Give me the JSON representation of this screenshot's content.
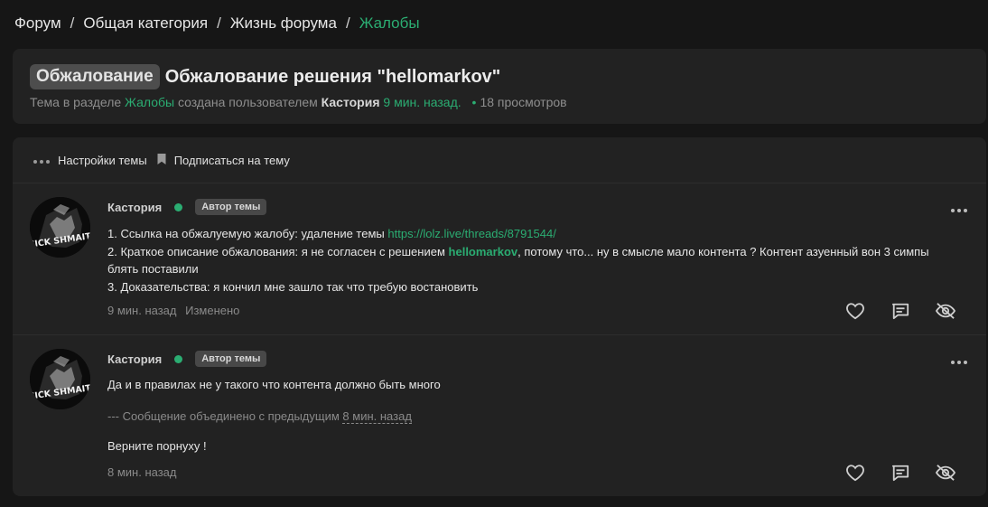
{
  "breadcrumb": {
    "items": [
      "Форум",
      "Общая категория",
      "Жизнь форума",
      "Жалобы"
    ],
    "separator": "/"
  },
  "thread": {
    "prefix": "Обжалование",
    "title": "Обжалование решения \"hellomarkov\"",
    "meta": {
      "text1": "Тема в разделе",
      "section": "Жалобы",
      "text2": "создана пользователем",
      "author": "Кастория",
      "time": "9 мин. назад.",
      "dot": "•",
      "views": "18 просмотров"
    }
  },
  "tools": {
    "settings": "Настройки темы",
    "subscribe": "Подписаться на тему"
  },
  "posts": [
    {
      "author": "Кастория",
      "badge": "Автор темы",
      "line1_text": "1. Ссылка на обжалуемую жалобу: удаление темы",
      "line1_link": "https://lolz.live/threads/8791544/",
      "line2_pre": "2. Краткое описание обжалования: я не согласен с решением",
      "line2_user": "hellomarkov",
      "line2_post": ", потому что... ну в смысле мало контента ? Контент азуенный вон 3 симпы",
      "line3": "блять поставили",
      "line4": "3. Доказательства: я кончил мне зашло так что требую востановить",
      "time": "9 мин. назад",
      "edited": "Изменено"
    },
    {
      "author": "Кастория",
      "badge": "Автор темы",
      "line1": "Да и в правилах не у такого что контента должно быть много",
      "merged_pre": "--- Сообщение объединено с предыдущим",
      "merged_time": "8 мин. назад",
      "line2": "Верните порнуху !",
      "time": "8 мин. назад"
    }
  ],
  "avatar_text": "NICK SHMAIT",
  "colors": {
    "accent": "#2bad72",
    "background": "#161616",
    "panel": "#222222"
  },
  "icons": [
    "dots-icon",
    "bookmark-icon",
    "more-icon",
    "heart-icon",
    "reply-icon",
    "hide-icon"
  ]
}
